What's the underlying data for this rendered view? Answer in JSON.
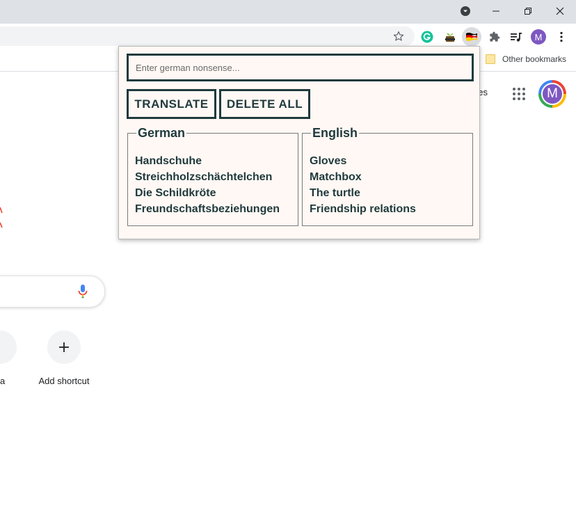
{
  "browser": {
    "bookmarks_bar": {
      "other_bookmarks_label": "Other bookmarks"
    },
    "profile_initial": "M"
  },
  "ntp": {
    "images_link_partial": "ges",
    "profile_initial": "M",
    "shortcut_partial_label": "a",
    "add_shortcut_label": "Add shortcut"
  },
  "popup": {
    "input_placeholder": "Enter german nonsense...",
    "translate_label": "TRANSLATE",
    "delete_all_label": "DELETE ALL",
    "german_legend": "German",
    "english_legend": "English",
    "german_words": [
      "Handschuhe",
      "Streichholzschächtelchen",
      "Die Schildkröte",
      "Freundschaftsbeziehungen"
    ],
    "english_words": [
      "Gloves",
      "Matchbox",
      "The turtle",
      "Friendship relations"
    ]
  },
  "colors": {
    "popup_bg": "#fff8f4",
    "popup_accent": "#1f3a3d",
    "avatar": "#7e57c2"
  }
}
